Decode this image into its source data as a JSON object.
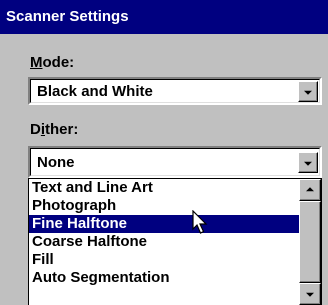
{
  "window": {
    "title": "Scanner Settings"
  },
  "mode": {
    "label_mnemonic": "M",
    "label_rest": "ode:",
    "value": "Black and White"
  },
  "dither": {
    "label_first": "D",
    "label_mnemonic": "i",
    "label_rest": "ther:",
    "value": "None",
    "options": [
      "Text and Line Art",
      "Photograph",
      "Fine Halftone",
      "Coarse Halftone",
      "Fill",
      "Auto Segmentation"
    ],
    "highlighted": "Fine Halftone"
  },
  "icons": {
    "dropdown": "chevron-down-icon",
    "scroll_up": "scroll-up-arrow-icon",
    "scroll_down": "scroll-down-arrow-icon",
    "cursor": "mouse-pointer-icon"
  },
  "colors": {
    "title_bar": "#000080",
    "selection": "#000080",
    "dialog_bg": "#c0c0c0"
  }
}
